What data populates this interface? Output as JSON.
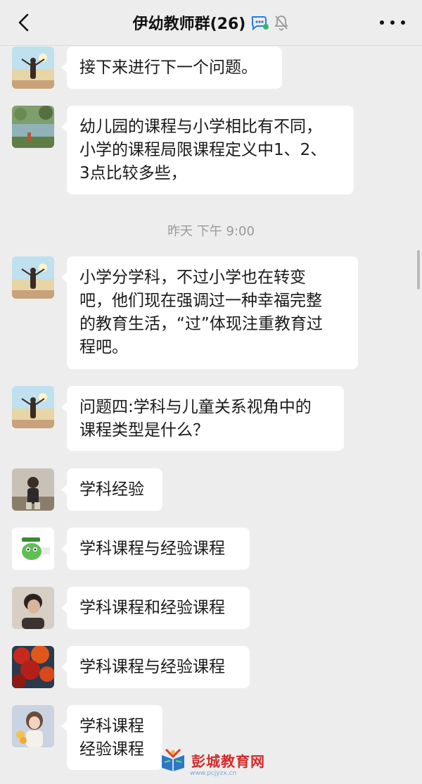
{
  "header": {
    "title": "伊幼教师群(26)",
    "back_icon": "chevron-left-icon",
    "group_icon": "group-chat-icon",
    "mute_icon": "bell-muted-icon",
    "more_icon": "more-dots-icon"
  },
  "messages": [
    {
      "avatar": "avatar-woman-sunset",
      "text": "接下来进行下一个问题。"
    },
    {
      "avatar": "avatar-lake-landscape",
      "text": "幼儿园的课程与小学相比有不同，\n小学的课程局限课程定义中1、2、\n3点比较多些，"
    },
    {
      "avatar": "avatar-woman-sunset",
      "text": "小学分学科，不过小学也在转变\n吧，他们现在强调过一种幸福完整\n的教育生活，“过”体现注重教育过\n程吧。"
    },
    {
      "avatar": "avatar-woman-sunset",
      "text": "问题四:学科与儿童关系视角中的\n课程类型是什么？"
    },
    {
      "avatar": "avatar-child-photo",
      "text": "学科经验"
    },
    {
      "avatar": "avatar-green-cartoon",
      "text": "学科课程与经验课程"
    },
    {
      "avatar": "avatar-man-portrait",
      "text": "学科课程和经验课程"
    },
    {
      "avatar": "avatar-red-leaves",
      "text": "学科课程与经验课程"
    },
    {
      "avatar": "avatar-girl-flowers",
      "text": "学科课程\n经验课程"
    }
  ],
  "timestamp": "昨天 下午 9:00",
  "watermark": {
    "name": "彭城教育网",
    "url": "www.pcjyzx.cn"
  }
}
